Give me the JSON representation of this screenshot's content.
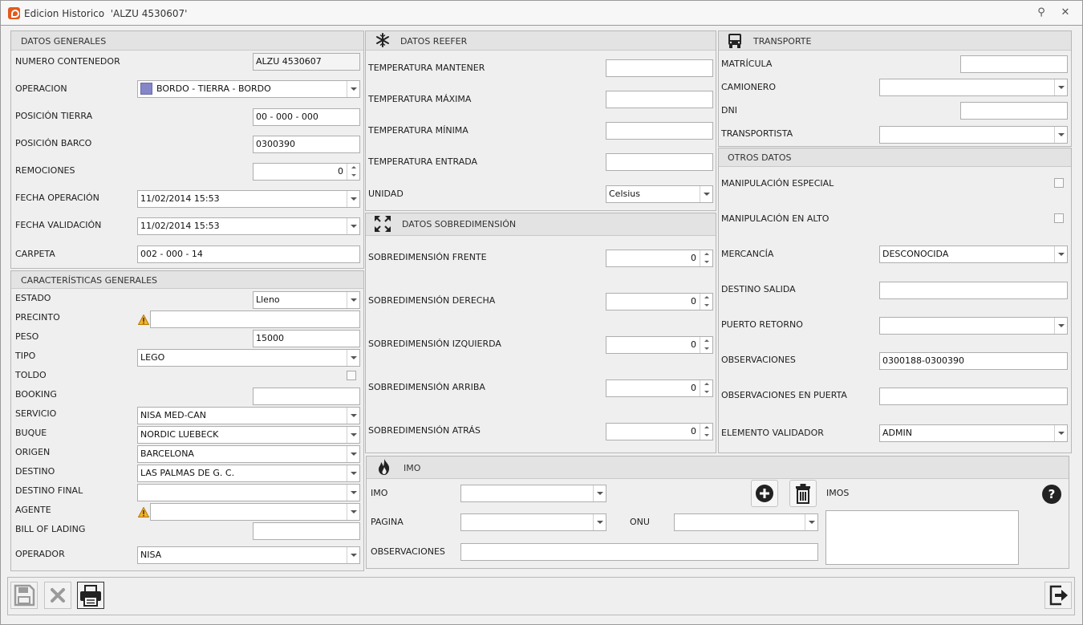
{
  "window": {
    "title": "Edicion Historico  'ALZU 4530607'"
  },
  "datos_generales": {
    "header": "DATOS GENERALES",
    "numero_contenedor": {
      "label": "NUMERO CONTENEDOR",
      "value": "ALZU 4530607"
    },
    "operacion": {
      "label": "OPERACION",
      "value": "BORDO - TIERRA - BORDO",
      "color": "#8585c8"
    },
    "posicion_tierra": {
      "label": "POSICIÓN TIERRA",
      "value": "00 - 000 - 000"
    },
    "posicion_barco": {
      "label": "POSICIÓN BARCO",
      "value": "0300390"
    },
    "remociones": {
      "label": "REMOCIONES",
      "value": "0"
    },
    "fecha_operacion": {
      "label": "FECHA OPERACIÓN",
      "value": "11/02/2014 15:53"
    },
    "fecha_validacion": {
      "label": "FECHA VALIDACIÓN",
      "value": "11/02/2014 15:53"
    },
    "carpeta": {
      "label": "CARPETA",
      "value": "002 - 000 - 14"
    }
  },
  "caracteristicas": {
    "header": "CARACTERÍSTICAS GENERALES",
    "estado": {
      "label": "ESTADO",
      "value": "Lleno"
    },
    "precinto": {
      "label": "PRECINTO",
      "value": ""
    },
    "peso": {
      "label": "PESO",
      "value": "15000"
    },
    "tipo": {
      "label": "TIPO",
      "value": "LEGO"
    },
    "toldo": {
      "label": "TOLDO"
    },
    "booking": {
      "label": "BOOKING",
      "value": ""
    },
    "servicio": {
      "label": "SERVICIO",
      "value": "NISA MED-CAN"
    },
    "buque": {
      "label": "BUQUE",
      "value": "NORDIC LUEBECK"
    },
    "origen": {
      "label": "ORIGEN",
      "value": "BARCELONA"
    },
    "destino": {
      "label": "DESTINO",
      "value": "LAS PALMAS DE G. C."
    },
    "destino_final": {
      "label": "DESTINO FINAL",
      "value": ""
    },
    "agente": {
      "label": "AGENTE",
      "value": ""
    },
    "bill_of_lading": {
      "label": "BILL OF LADING",
      "value": ""
    },
    "operador": {
      "label": "OPERADOR",
      "value": "NISA"
    }
  },
  "reefer": {
    "header": "DATOS REEFER",
    "temp_mantener": {
      "label": "TEMPERATURA MANTENER",
      "value": ""
    },
    "temp_maxima": {
      "label": "TEMPERATURA MÁXIMA",
      "value": ""
    },
    "temp_minima": {
      "label": "TEMPERATURA MÍNIMA",
      "value": ""
    },
    "temp_entrada": {
      "label": "TEMPERATURA ENTRADA",
      "value": ""
    },
    "unidad": {
      "label": "UNIDAD",
      "value": "Celsius"
    }
  },
  "sobredimension": {
    "header": "DATOS SOBREDIMENSIÓN",
    "frente": {
      "label": "SOBREDIMENSIÓN FRENTE",
      "value": "0"
    },
    "derecha": {
      "label": "SOBREDIMENSIÓN DERECHA",
      "value": "0"
    },
    "izquierda": {
      "label": "SOBREDIMENSIÓN IZQUIERDA",
      "value": "0"
    },
    "arriba": {
      "label": "SOBREDIMENSIÓN ARRIBA",
      "value": "0"
    },
    "atras": {
      "label": "SOBREDIMENSIÓN ATRÁS",
      "value": "0"
    }
  },
  "transporte": {
    "header": "TRANSPORTE",
    "matricula": {
      "label": "MATRÍCULA",
      "value": ""
    },
    "camionero": {
      "label": "CAMIONERO",
      "value": ""
    },
    "dni": {
      "label": "DNI",
      "value": ""
    },
    "transportista": {
      "label": "TRANSPORTISTA",
      "value": ""
    }
  },
  "otros": {
    "header": "OTROS DATOS",
    "manip_especial": {
      "label": "MANIPULACIÓN ESPECIAL"
    },
    "manip_alto": {
      "label": "MANIPULACIÓN EN ALTO"
    },
    "mercancia": {
      "label": "MERCANCÍA",
      "value": "DESCONOCIDA"
    },
    "destino_salida": {
      "label": "DESTINO SALIDA",
      "value": ""
    },
    "puerto_retorno": {
      "label": "PUERTO RETORNO",
      "value": ""
    },
    "observaciones": {
      "label": "OBSERVACIONES",
      "value": "0300188-0300390"
    },
    "obs_puerta": {
      "label": "OBSERVACIONES EN PUERTA",
      "value": ""
    },
    "elemento_validador": {
      "label": "ELEMENTO VALIDADOR",
      "value": "ADMIN"
    }
  },
  "imo": {
    "header": "IMO",
    "imo": {
      "label": "IMO",
      "value": ""
    },
    "pagina": {
      "label": "PAGINA",
      "value": ""
    },
    "onu": {
      "label": "ONU",
      "value": ""
    },
    "observaciones": {
      "label": "OBSERVACIONES",
      "value": ""
    },
    "imos_label": "IMOS"
  },
  "icons": {
    "add": "plus-circle-icon",
    "delete": "trash-icon",
    "help": "question-icon",
    "save": "save-icon",
    "cancel": "x-icon",
    "print": "printer-icon",
    "exit": "exit-icon",
    "reefer": "snowflake-icon",
    "sobredimension": "expand-icon",
    "transporte": "truck-icon",
    "imo": "flame-icon"
  }
}
